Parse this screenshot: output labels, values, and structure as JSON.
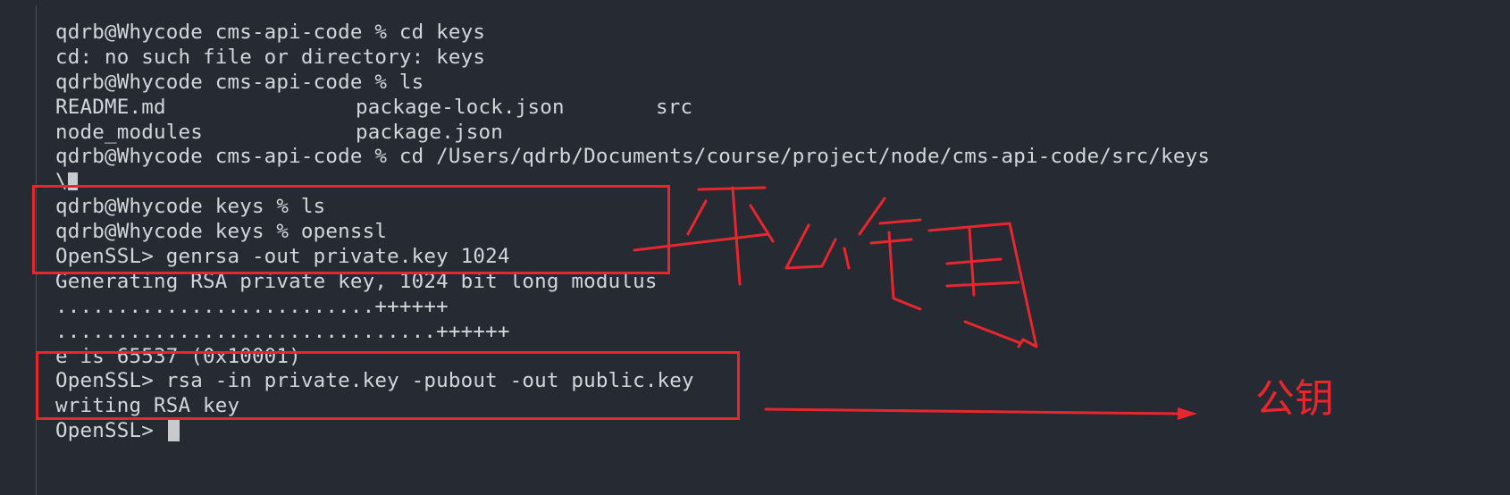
{
  "terminal": {
    "lines": [
      "qdrb@Whycode cms-api-code % cd keys",
      "cd: no such file or directory: keys",
      "qdrb@Whycode cms-api-code % ls",
      "qdrb@Whycode cms-api-code % cd /Users/qdrb/Documents/course/project/node/cms-api-code/src/keys",
      "\\",
      "qdrb@Whycode keys % ls",
      "qdrb@Whycode keys % openssl",
      "OpenSSL> genrsa -out private.key 1024",
      "Generating RSA private key, 1024 bit long modulus",
      "..........................++++++",
      "...............................++++++",
      "e is 65537 (0x10001)",
      "OpenSSL> rsa -in private.key -pubout -out public.key",
      "writing RSA key",
      "OpenSSL> "
    ],
    "ls_listing": [
      [
        "README.md",
        "package-lock.json",
        "src"
      ],
      [
        "node_modules",
        "package.json",
        ""
      ]
    ]
  },
  "annotations": {
    "private_key_label": "私钥",
    "public_key_label": "公钥",
    "color": "#e8262e"
  },
  "colors": {
    "background": "#262a33",
    "text": "#d4d6da"
  }
}
